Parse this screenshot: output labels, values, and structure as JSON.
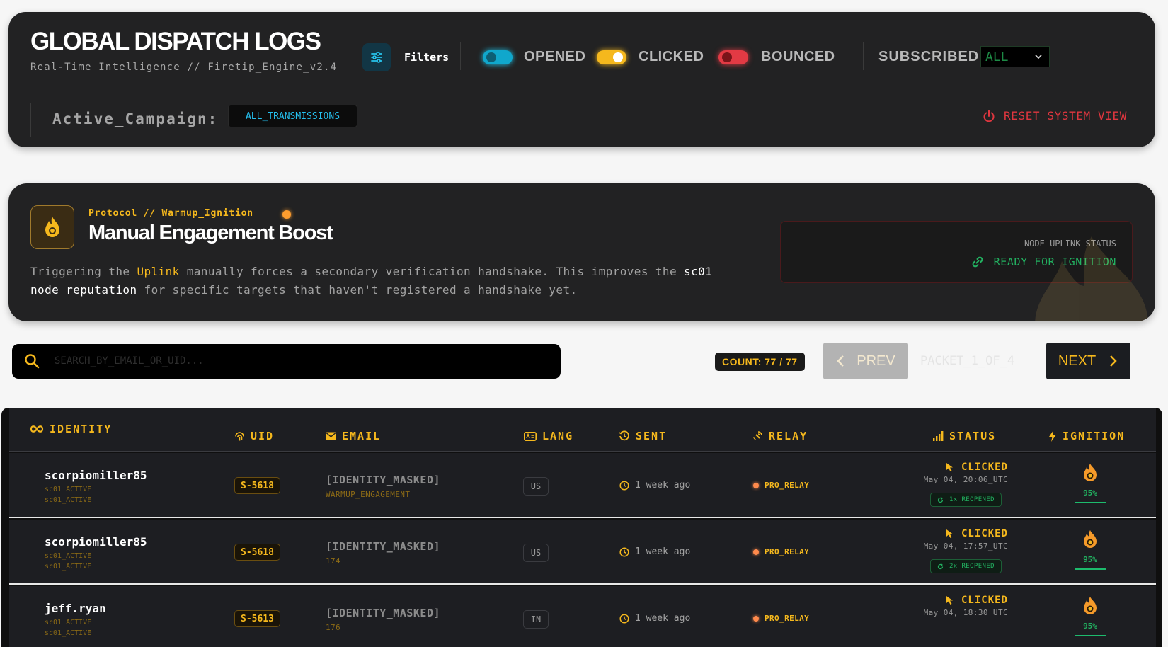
{
  "header": {
    "title": "GLOBAL DISPATCH LOGS",
    "subtitle": "Real-Time Intelligence // Firetip_Engine_v2.4",
    "filters_label": "Filters",
    "toggles": [
      {
        "label": "OPENED",
        "color": "#1ec8ef",
        "on": true
      },
      {
        "label": "CLICKED",
        "color": "#f5b81d",
        "on": true
      },
      {
        "label": "BOUNCED",
        "color": "#e23a44",
        "on": true
      }
    ],
    "subscribed_label": "SUBSCRIBED:",
    "subscribed_value": "ALL",
    "campaign_label": "Active_Campaign:",
    "campaign_value": "ALL_TRANSMISSIONS",
    "reset_label": "RESET_SYSTEM_VIEW"
  },
  "protocol": {
    "kicker": "Protocol // Warmup_Ignition",
    "title": "Manual Engagement Boost",
    "desc_1": "Triggering the ",
    "desc_hl_1": "Uplink",
    "desc_2": " manually forces a secondary verification handshake. This improves the ",
    "desc_hl_2": "sc01 node reputation",
    "desc_3": " for specific targets that haven't registered a handshake yet.",
    "status_key": "NODE_UPLINK_STATUS",
    "status_value": "READY_FOR_IGNITION"
  },
  "search": {
    "placeholder": "SEARCH_BY_EMAIL_OR_UID...",
    "value": ""
  },
  "pagination": {
    "count": "COUNT: 77 / 77",
    "prev": "PREV",
    "packet": "PACKET_1_OF_4",
    "next": "NEXT"
  },
  "table": {
    "columns": [
      "IDENTITY",
      "UID",
      "EMAIL",
      "LANG",
      "SENT",
      "RELAY",
      "STATUS",
      "IGNITION"
    ],
    "rows": [
      {
        "username": "scorpiomiller85",
        "tag1": "sc01_ACTIVE",
        "tag2": "sc01_ACTIVE",
        "uid": "S-5618",
        "email": "[IDENTITY_MASKED]",
        "email_sub": "WARMUP_ENGAGEMENT",
        "lang": "US",
        "sent": "1 week ago",
        "relay": "PRO_RELAY",
        "status": "CLICKED",
        "status_time": "May 04, 20:06_UTC",
        "reopened": "1x REOPENED",
        "ignition": "95%"
      },
      {
        "username": "scorpiomiller85",
        "tag1": "sc01_ACTIVE",
        "tag2": "sc01_ACTIVE",
        "uid": "S-5618",
        "email": "[IDENTITY_MASKED]",
        "email_sub": "174",
        "lang": "US",
        "sent": "1 week ago",
        "relay": "PRO_RELAY",
        "status": "CLICKED",
        "status_time": "May 04, 17:57_UTC",
        "reopened": "2x REOPENED",
        "ignition": "95%"
      },
      {
        "username": "jeff.ryan",
        "tag1": "sc01_ACTIVE",
        "tag2": "sc01_ACTIVE",
        "uid": "S-5613",
        "email": "[IDENTITY_MASKED]",
        "email_sub": "176",
        "lang": "IN",
        "sent": "1 week ago",
        "relay": "PRO_RELAY",
        "status": "CLICKED",
        "status_time": "May 04, 18:30_UTC",
        "ignition": "95%"
      }
    ]
  }
}
